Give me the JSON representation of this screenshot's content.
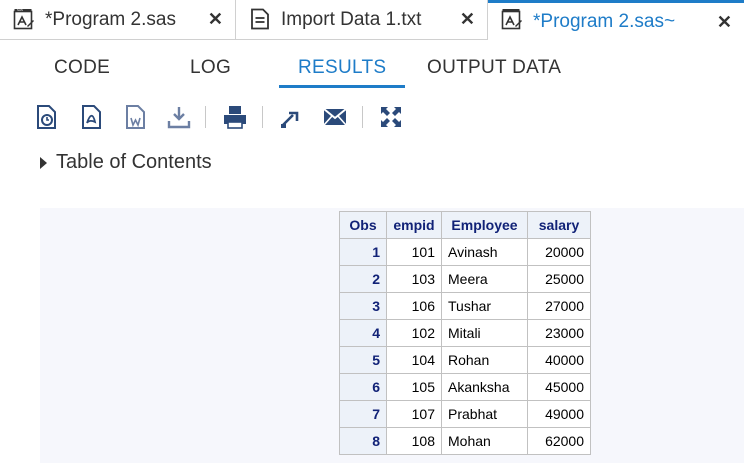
{
  "tabs": [
    {
      "label": "*Program 2.sas",
      "icon": "sas-program-icon",
      "close": "✕"
    },
    {
      "label": "Import Data 1.txt",
      "icon": "text-file-icon",
      "close": "✕"
    },
    {
      "label": "*Program 2.sas~",
      "icon": "sas-program-icon",
      "close": "✕"
    }
  ],
  "subtabs": [
    "CODE",
    "LOG",
    "RESULTS",
    "OUTPUT DATA"
  ],
  "toolbar": [
    "html-download-icon",
    "pdf-download-icon",
    "word-download-icon",
    "download-icon",
    "print-icon",
    "open-new-window-icon",
    "email-icon",
    "expand-icon"
  ],
  "toc": {
    "label": "Table of Contents"
  },
  "table": {
    "headers": [
      "Obs",
      "empid",
      "Employee",
      "salary"
    ],
    "rows": [
      [
        "1",
        "101",
        "Avinash",
        "20000"
      ],
      [
        "2",
        "103",
        "Meera",
        "25000"
      ],
      [
        "3",
        "106",
        "Tushar",
        "27000"
      ],
      [
        "4",
        "102",
        "Mitali",
        "23000"
      ],
      [
        "5",
        "104",
        "Rohan",
        "40000"
      ],
      [
        "6",
        "105",
        "Akanksha",
        "45000"
      ],
      [
        "7",
        "107",
        "Prabhat",
        "49000"
      ],
      [
        "8",
        "108",
        "Mohan",
        "62000"
      ]
    ]
  },
  "colors": {
    "accent": "#1e7cc8",
    "header_text": "#112277",
    "header_bg": "#edf2f9",
    "panel_bg": "#f6f7fc"
  }
}
